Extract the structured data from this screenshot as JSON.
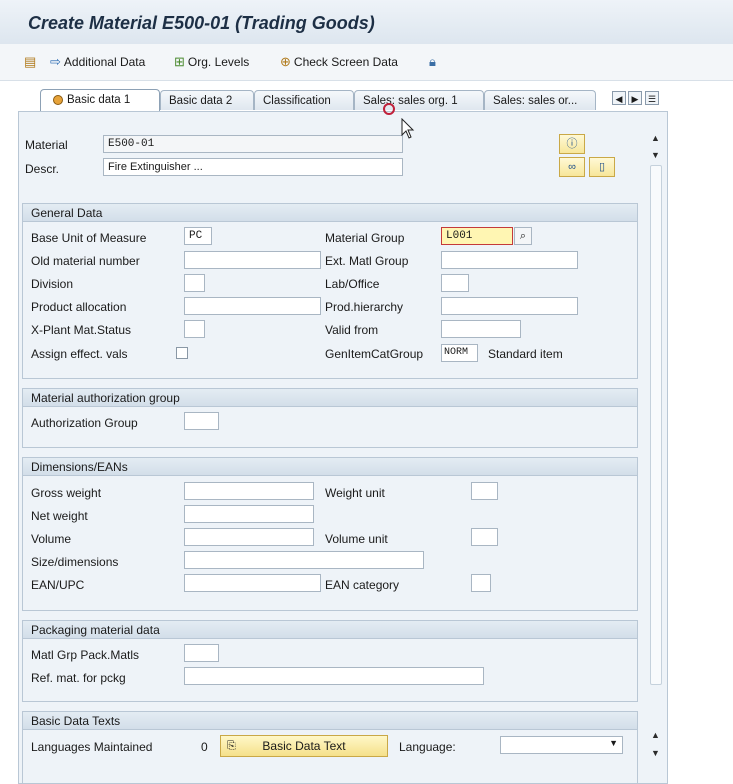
{
  "window": {
    "title": "Create Material E500-01 (Trading Goods)"
  },
  "toolbar": {
    "additional_data": "Additional Data",
    "org_levels": "Org. Levels",
    "check_screen_data": "Check Screen Data"
  },
  "tabs": [
    {
      "label": "Basic data 1"
    },
    {
      "label": "Basic data 2"
    },
    {
      "label": "Classification"
    },
    {
      "label": "Sales: sales org. 1"
    },
    {
      "label": "Sales: sales or..."
    }
  ],
  "header": {
    "material_label": "Material",
    "material_value": "E500-01",
    "descr_label": "Descr.",
    "descr_value": "Fire Extinguisher ..."
  },
  "general": {
    "title": "General Data",
    "base_uom_label": "Base Unit of Measure",
    "base_uom_value": "PC",
    "old_matnr_label": "Old material number",
    "division_label": "Division",
    "prod_alloc_label": "Product allocation",
    "xplant_label": "X-Plant Mat.Status",
    "assign_label": "Assign effect. vals",
    "mat_group_label": "Material Group",
    "mat_group_value": "L001",
    "ext_matl_label": "Ext. Matl Group",
    "lab_office_label": "Lab/Office",
    "prod_hier_label": "Prod.hierarchy",
    "valid_from_label": "Valid from",
    "gen_item_label": "GenItemCatGroup",
    "gen_item_value": "NORM",
    "gen_item_text": "Standard item"
  },
  "auth": {
    "title": "Material authorization group",
    "auth_group_label": "Authorization Group"
  },
  "dims": {
    "title": "Dimensions/EANs",
    "gross_label": "Gross weight",
    "net_label": "Net weight",
    "volume_label": "Volume",
    "size_label": "Size/dimensions",
    "ean_label": "EAN/UPC",
    "weight_unit_label": "Weight unit",
    "volume_unit_label": "Volume unit",
    "ean_cat_label": "EAN category"
  },
  "pack": {
    "title": "Packaging material data",
    "matl_grp_label": "Matl Grp Pack.Matls",
    "ref_mat_label": "Ref. mat. for pckg"
  },
  "texts": {
    "title": "Basic Data Texts",
    "lang_maintained_label": "Languages Maintained",
    "lang_count": "0",
    "basic_text_button": "Basic Data Text",
    "language_label": "Language:"
  },
  "colors": {
    "accent": "#1d2f45",
    "required": "#c43a3a",
    "highlight": "#fff6b3"
  }
}
